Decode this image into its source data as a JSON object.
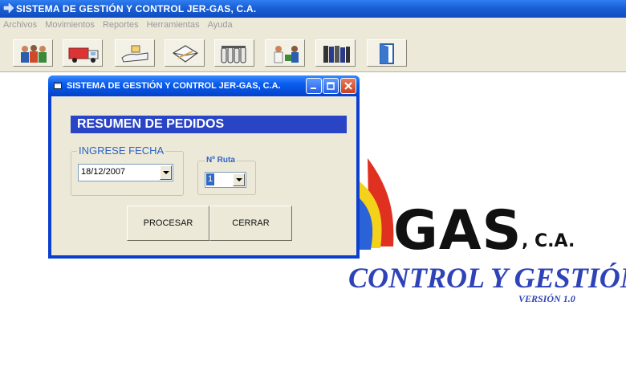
{
  "app": {
    "title": "SISTEMA DE GESTIÓN Y CONTROL JER-GAS, C.A."
  },
  "menu": [
    "Archivos",
    "Movimientos",
    "Reportes",
    "Herramientas",
    "Ayuda"
  ],
  "toolbar": {
    "icons": [
      "customers-icon",
      "truck-icon",
      "delivery-hand-icon",
      "envelope-icon",
      "gas-cylinders-icon",
      "doctor-icon",
      "books-icon",
      "exit-door-icon"
    ]
  },
  "logo": {
    "brand": "GAS",
    "suffix": ", C.A.",
    "tagline": "CONTROL Y GESTIÓN",
    "version": "VERSIÓN 1.0",
    "colors": {
      "tagline": "#2f43b8",
      "flame_red": "#e03020",
      "flame_yellow": "#f5d21a",
      "flame_blue": "#2a62d8"
    }
  },
  "dialog": {
    "title": "SISTEMA DE GESTIÓN Y CONTROL JER-GAS, C.A.",
    "banner": "RESUMEN DE PEDIDOS",
    "date_group_label": "INGRESE FECHA",
    "date_value": "18/12/2007",
    "route_group_label": "Nº Ruta",
    "route_value": "1",
    "process_button": "PROCESAR",
    "close_button": "CERRAR",
    "colors": {
      "banner": "#2a44c6",
      "legend": "#2d63c8"
    }
  }
}
